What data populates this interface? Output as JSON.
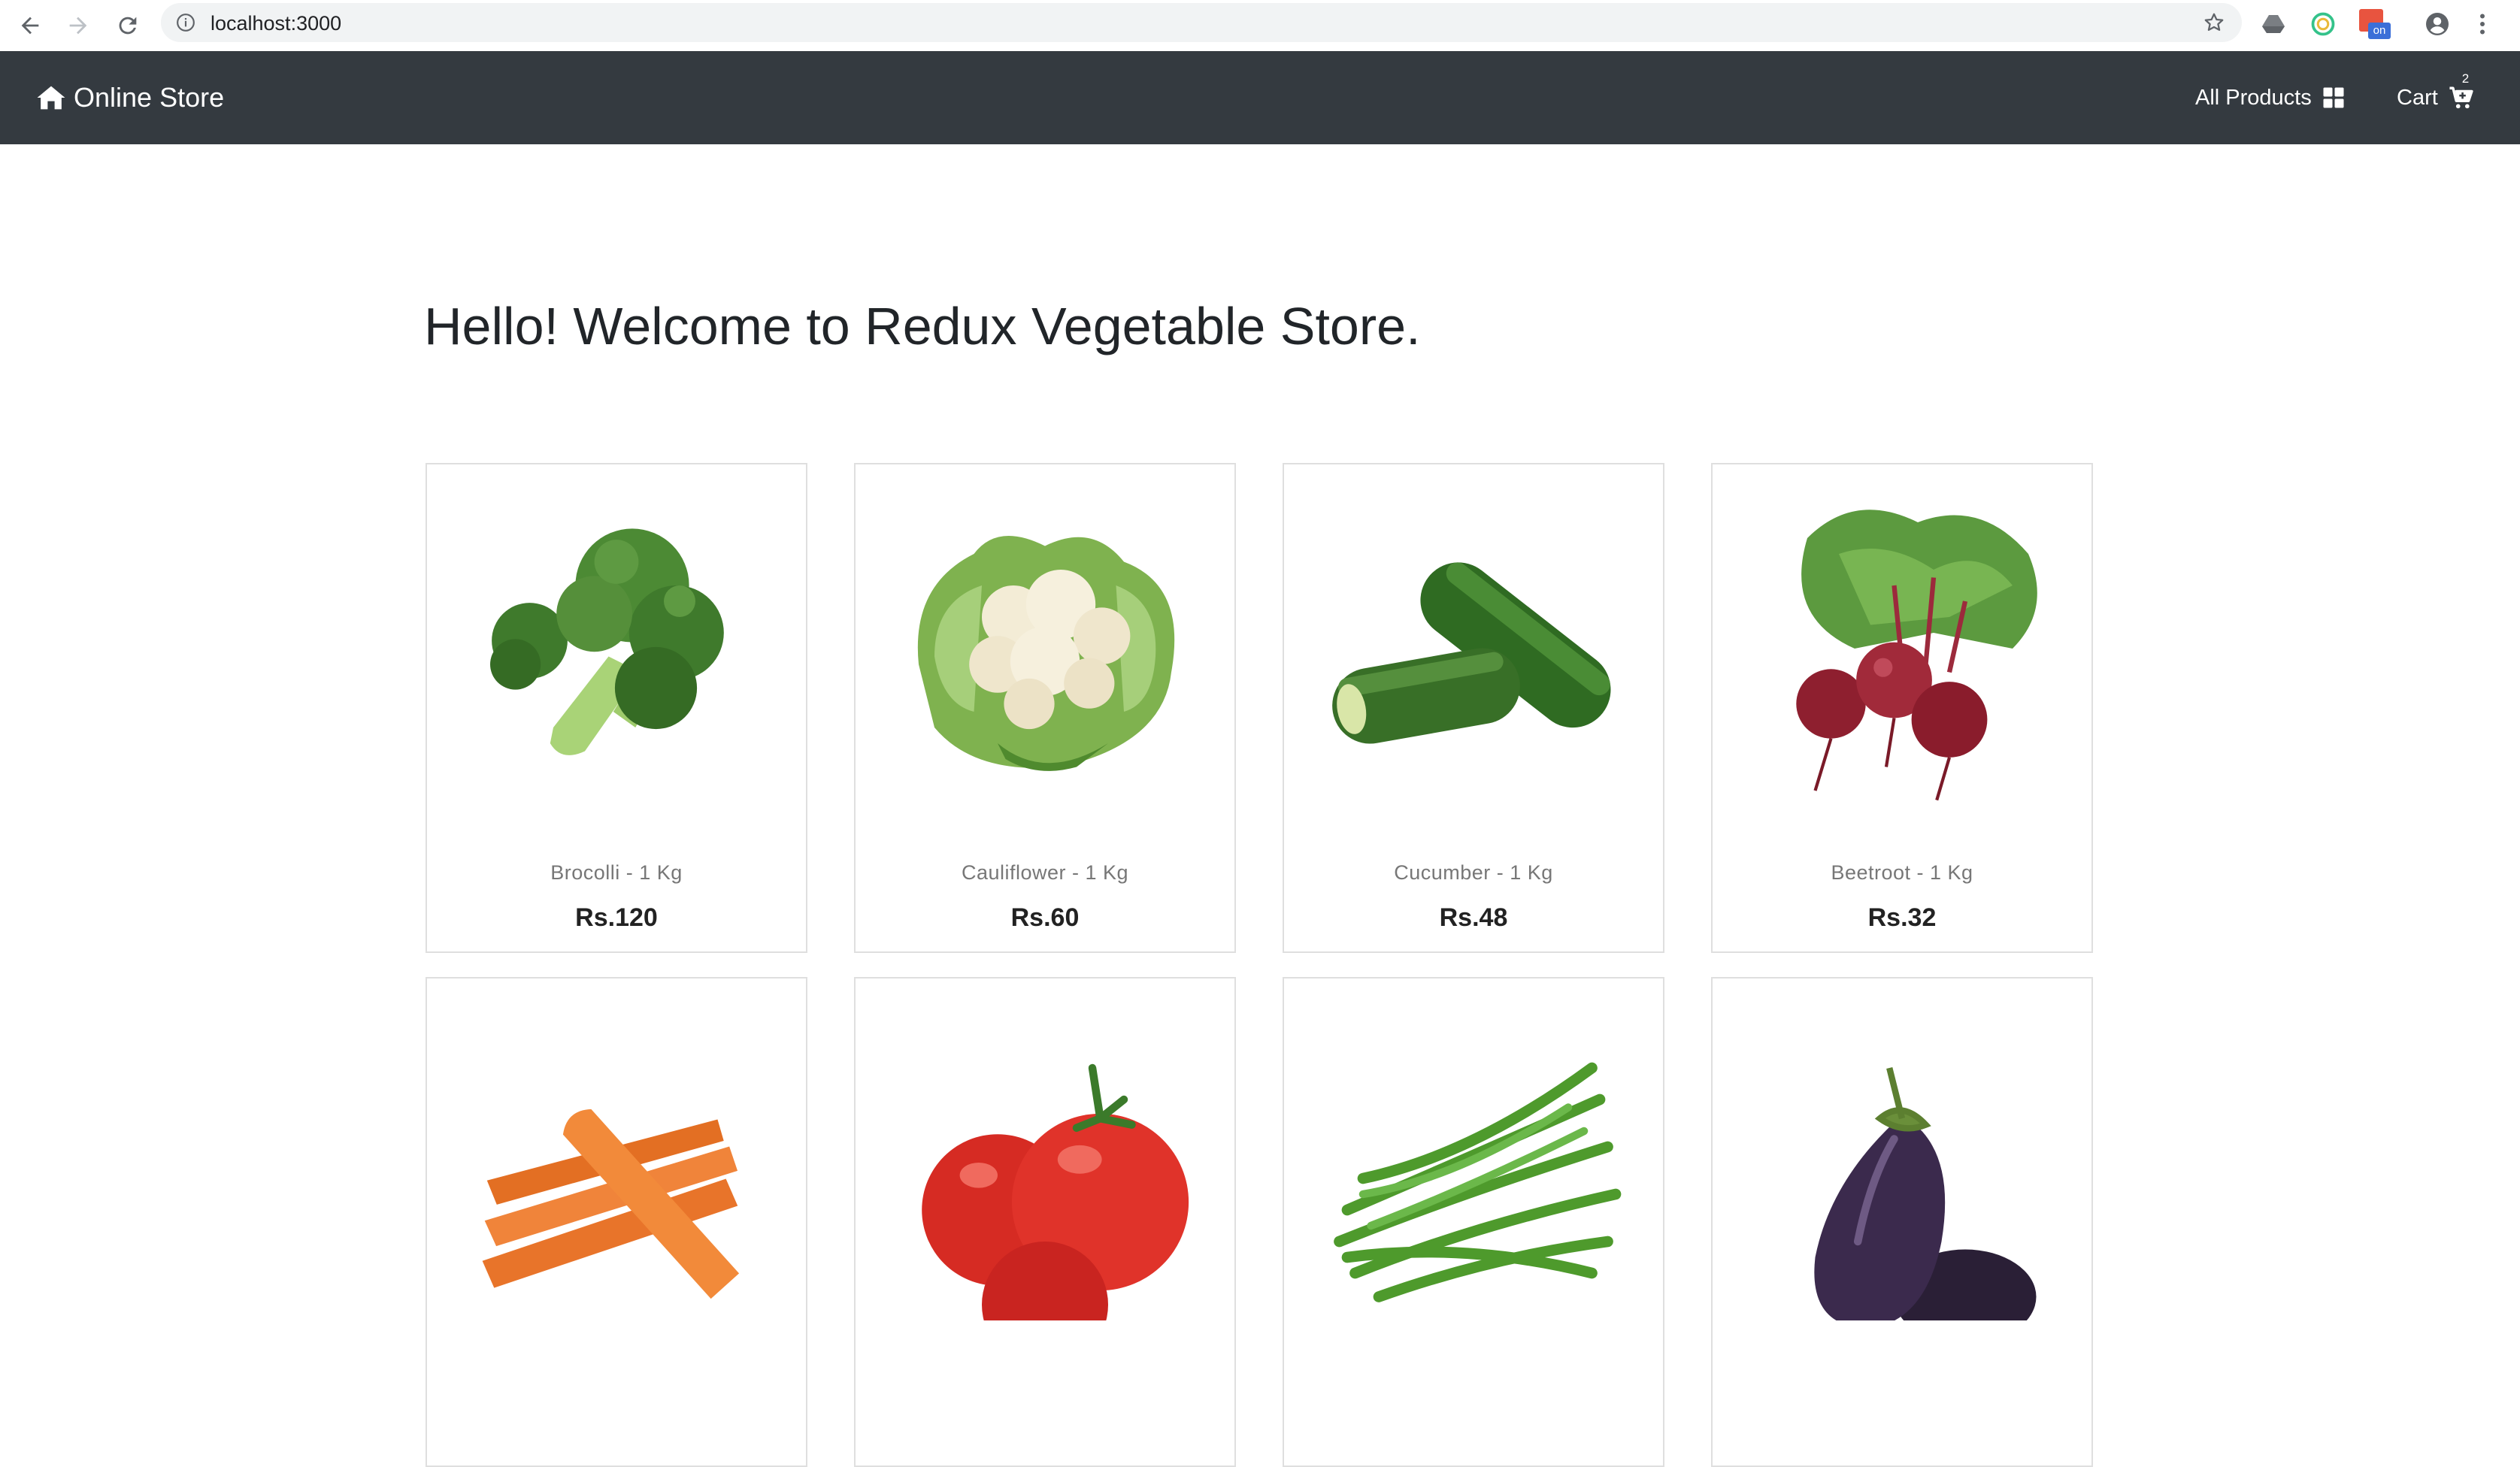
{
  "browser": {
    "url": "localhost:3000",
    "extension_badge": "on",
    "icons": [
      "back-icon",
      "forward-icon",
      "reload-icon",
      "info-icon",
      "star-icon",
      "drive-icon",
      "extension-icon",
      "profile-icon",
      "menu-icon"
    ]
  },
  "navbar": {
    "brand": "Online Store",
    "all_products": "All Products",
    "cart": "Cart",
    "cart_count": "2",
    "background": "#343a40"
  },
  "main": {
    "heading": "Hello! Welcome to Redux Vegetable Store."
  },
  "products": [
    {
      "name": "Brocolli - 1 Kg",
      "price": "Rs.120",
      "image": "broccoli"
    },
    {
      "name": "Cauliflower - 1 Kg",
      "price": "Rs.60",
      "image": "cauliflower"
    },
    {
      "name": "Cucumber - 1 Kg",
      "price": "Rs.48",
      "image": "cucumber"
    },
    {
      "name": "Beetroot - 1 Kg",
      "price": "Rs.32",
      "image": "beetroot"
    },
    {
      "name": "",
      "price": "",
      "image": "carrot"
    },
    {
      "name": "",
      "price": "",
      "image": "tomato"
    },
    {
      "name": "",
      "price": "",
      "image": "beans"
    },
    {
      "name": "",
      "price": "",
      "image": "brinjal"
    }
  ]
}
